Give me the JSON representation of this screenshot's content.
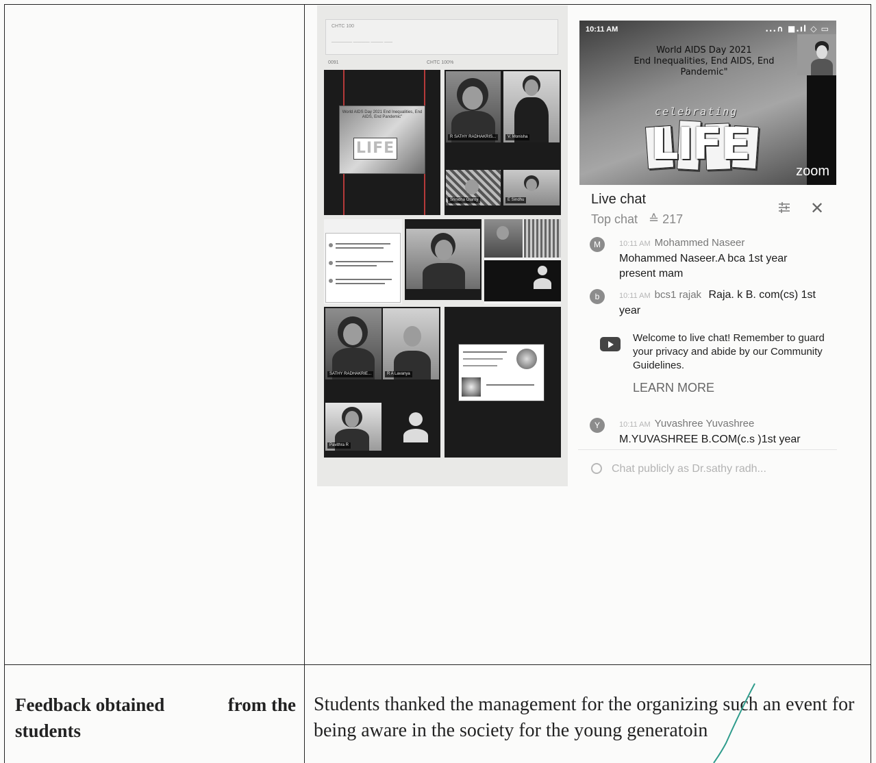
{
  "document": {
    "feedback_label_line1_a": "Feedback obtained",
    "feedback_label_line1_b": "from the",
    "feedback_label_line2": "students",
    "feedback_text": "Students thanked the management for the organizing such an event for being aware in the society for the young generatoin"
  },
  "phone": {
    "status_time": "10:11 AM",
    "status_icons": "...∩ ■.ıl ◇ ▭",
    "video_title_line1": "World AIDS Day 2021",
    "video_title_line2": "End Inequalities, End AIDS, End",
    "video_title_line3": "Pandemic\"",
    "video_celebrating": "celebrating",
    "video_life": "LIFE",
    "video_watermark": "zoom",
    "live_chat_title": "Live chat",
    "top_chat_label": "Top chat",
    "viewer_count": "≙ 217",
    "messages": [
      {
        "avatar": "M",
        "time": "10:11 AM",
        "author": "Mohammed Naseer",
        "text": "Mohammed Naseer.A bca 1st year present mam"
      },
      {
        "avatar": "b",
        "time": "10:11 AM",
        "author": "bcs1 rajak",
        "text": "Raja. k B. com(cs) 1st year"
      },
      {
        "avatar": "Y",
        "time": "10:11 AM",
        "author": "Yuvashree Yuvashree",
        "text": "M.YUVASHREE B.COM(c.s )1st year"
      }
    ],
    "welcome_text": "Welcome to live chat! Remember to guard your privacy and abide by our Community Guidelines.",
    "learn_more": "LEARN MORE",
    "chat_placeholder": "Chat publicly as Dr.sathy radh..."
  },
  "collage": {
    "topbar_text": "CHTC 100",
    "strip_left": "0091",
    "strip_right": "CHTC 100%",
    "mini_slide_title": "World AIDS Day 2021 End Inequalities, End AIDS, End Pandemic\"",
    "mini_slide_life": "LIFE",
    "tags": [
      "R SATHY RADHAKRIS...",
      "V. Monisha",
      "Srinidha Olaroy",
      "E Sindhu",
      "SATHY RADHAKRIE...",
      "R A Lavanya",
      "Pavithra R"
    ]
  }
}
